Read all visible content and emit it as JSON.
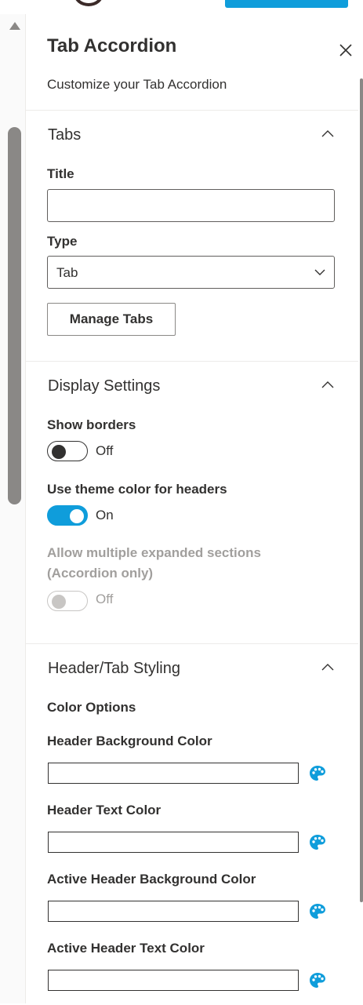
{
  "panel": {
    "title": "Tab Accordion",
    "subtitle": "Customize your Tab Accordion"
  },
  "tabs_section": {
    "title": "Tabs",
    "title_label": "Title",
    "title_value": "",
    "type_label": "Type",
    "type_value": "Tab",
    "manage_button": "Manage Tabs"
  },
  "display_section": {
    "title": "Display Settings",
    "show_borders": {
      "label": "Show borders",
      "state": "Off",
      "on": false
    },
    "theme_color": {
      "label": "Use theme color for headers",
      "state": "On",
      "on": true
    },
    "multiple_expanded": {
      "label_line1": "Allow multiple expanded sections",
      "label_line2": "(Accordion only)",
      "state": "Off",
      "on": false,
      "disabled": true
    }
  },
  "styling_section": {
    "title": "Header/Tab Styling",
    "color_options_label": "Color Options",
    "colors": [
      {
        "label": "Header Background Color",
        "value": ""
      },
      {
        "label": "Header Text Color",
        "value": ""
      },
      {
        "label": "Active Header Background Color",
        "value": ""
      },
      {
        "label": "Active Header Text Color",
        "value": ""
      }
    ]
  },
  "icons": {
    "close": "close-icon",
    "chevron": "chevron-up-icon",
    "dropdown": "chevron-down-icon",
    "palette": "palette-icon"
  },
  "colors": {
    "accent": "#0f9ddb",
    "text": "#323130",
    "disabled_text": "#a19f9d",
    "divider": "#edebe9"
  }
}
